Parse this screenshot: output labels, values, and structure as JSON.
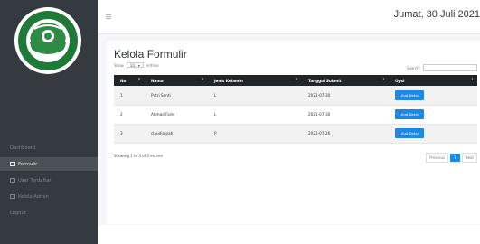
{
  "header": {
    "date": "Jumat, 30 Juli 2021"
  },
  "sidebar": {
    "items": [
      {
        "label": "Dashboard",
        "icon": "dashboard-icon"
      },
      {
        "label": "Formulir",
        "icon": "form-icon"
      },
      {
        "label": "User Terdaftar",
        "icon": "users-icon"
      },
      {
        "label": "Kelola Admin",
        "icon": "admin-icon"
      },
      {
        "label": "Logout",
        "icon": ""
      }
    ],
    "active_index": 1
  },
  "main": {
    "title": "Kelola Formulir",
    "show_label": "Show",
    "show_value": "10",
    "entries_label": "entries",
    "search_label": "Search:",
    "columns": [
      "No",
      "Nama",
      "Jenis Kelamin",
      "Tanggal Submit",
      "Opsi"
    ],
    "rows": [
      {
        "no": "1",
        "nama": "Putri Santi",
        "jk": "L",
        "tanggal": "2021-07-30",
        "opsi": "Lihat Detail"
      },
      {
        "no": "2",
        "nama": "Ahmad Farel",
        "jk": "L",
        "tanggal": "2021-07-30",
        "opsi": "Lihat Detail"
      },
      {
        "no": "3",
        "nama": "claudia.pati",
        "jk": "P",
        "tanggal": "2021-07-26",
        "opsi": "Lihat Detail"
      }
    ],
    "info": "Showing 1 to 3 of 3 entries",
    "pagination": {
      "previous": "Previous",
      "current": "1",
      "next": "Next"
    }
  },
  "colors": {
    "sidebar_bg": "#343a40",
    "table_header": "#212529",
    "accent": "#1e88e5"
  }
}
